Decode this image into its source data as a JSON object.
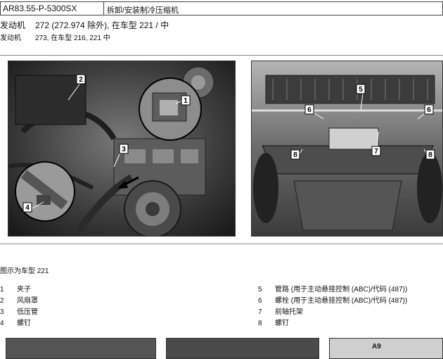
{
  "header": {
    "code": "AR83.55-P-5300SX",
    "title": "拆卸/安装制冷压缩机"
  },
  "engines": [
    {
      "label": "发动机",
      "value": "272 (272.974 除外), 在车型 221 / 中"
    },
    {
      "label": "发动机",
      "value": "273, 在车型 216, 221 中"
    }
  ],
  "figure": {
    "caption": "图示为车型 221",
    "panel_label_bottom_right": "A9",
    "callouts_left": [
      "1",
      "2",
      "3",
      "4"
    ],
    "callouts_right": [
      "5",
      "6",
      "6",
      "7",
      "8",
      "8"
    ]
  },
  "legend": {
    "left": [
      {
        "num": "1",
        "text": "夹子"
      },
      {
        "num": "2",
        "text": "风扇罩"
      },
      {
        "num": "3",
        "text": "低压管"
      },
      {
        "num": "4",
        "text": "螺钉"
      }
    ],
    "right": [
      {
        "num": "5",
        "text": "管路 (用于主动悬挂控制 (ABC)/代码 (487))"
      },
      {
        "num": "6",
        "text": "螺栓 (用于主动悬挂控制 (ABC)/代码 (487))"
      },
      {
        "num": "7",
        "text": "前轴托架"
      },
      {
        "num": "8",
        "text": "螺钉"
      }
    ]
  }
}
